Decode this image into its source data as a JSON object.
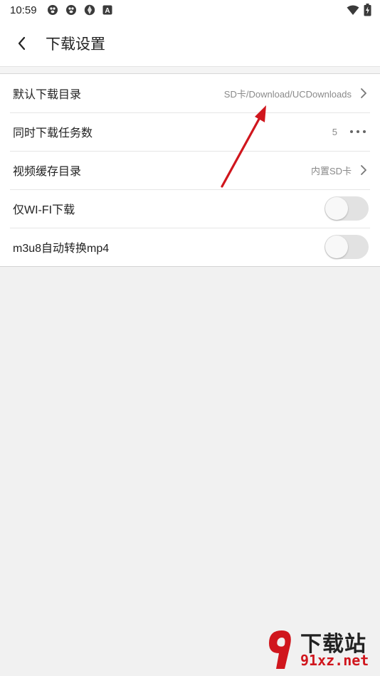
{
  "status_bar": {
    "time": "10:59",
    "left_icons": [
      "paw-icon",
      "paw-icon",
      "aperture-icon",
      "a-badge-icon"
    ],
    "right_icons": [
      "wifi-icon",
      "battery-charging-icon"
    ]
  },
  "app_bar": {
    "back_icon": "chevron-left-icon",
    "title": "下载设置"
  },
  "settings": {
    "rows": [
      {
        "label": "默认下载目录",
        "value": "SD卡/Download/UCDownloads",
        "control": "chevron"
      },
      {
        "label": "同时下载任务数",
        "value": "5",
        "control": "more-dots"
      },
      {
        "label": "视频缓存目录",
        "value": "内置SD卡",
        "control": "chevron"
      },
      {
        "label": "仅WI-FI下载",
        "value": "",
        "control": "toggle",
        "on": false
      },
      {
        "label": "m3u8自动转换mp4",
        "value": "",
        "control": "toggle",
        "on": false
      }
    ]
  },
  "annotation": {
    "color": "#d0161d"
  },
  "watermark": {
    "logo_text": "91",
    "main": "下载站",
    "sub": "91xz.net",
    "accent": "#d0161d"
  },
  "colors": {
    "background": "#f1f1f1",
    "surface": "#ffffff",
    "toggle_off": "#e2e2e2"
  }
}
